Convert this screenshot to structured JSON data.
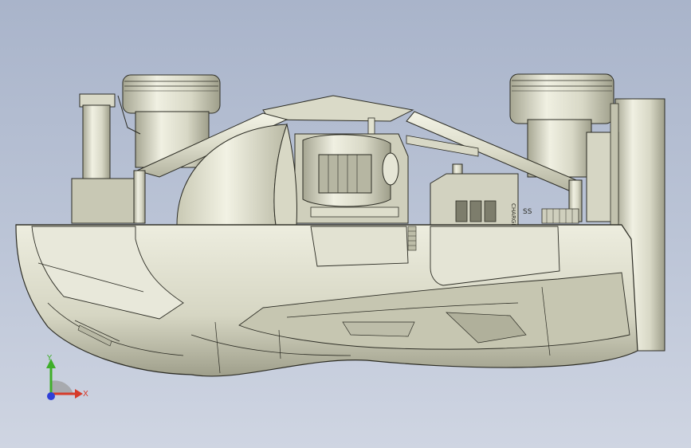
{
  "viewport": {
    "background_top": "#a9b4ca",
    "background_bottom": "#cfd5e2"
  },
  "model": {
    "body_color": "#e4e4d4",
    "shadow_color": "#a9a996",
    "edge_color": "#2c2c24",
    "part_label": "CHARGED",
    "side_marking": "SS"
  },
  "triad": {
    "y_label": "Y",
    "x_label": "X",
    "y_color": "#3fae2a",
    "x_color": "#d63b2a",
    "z_color": "#2f3fd8"
  }
}
